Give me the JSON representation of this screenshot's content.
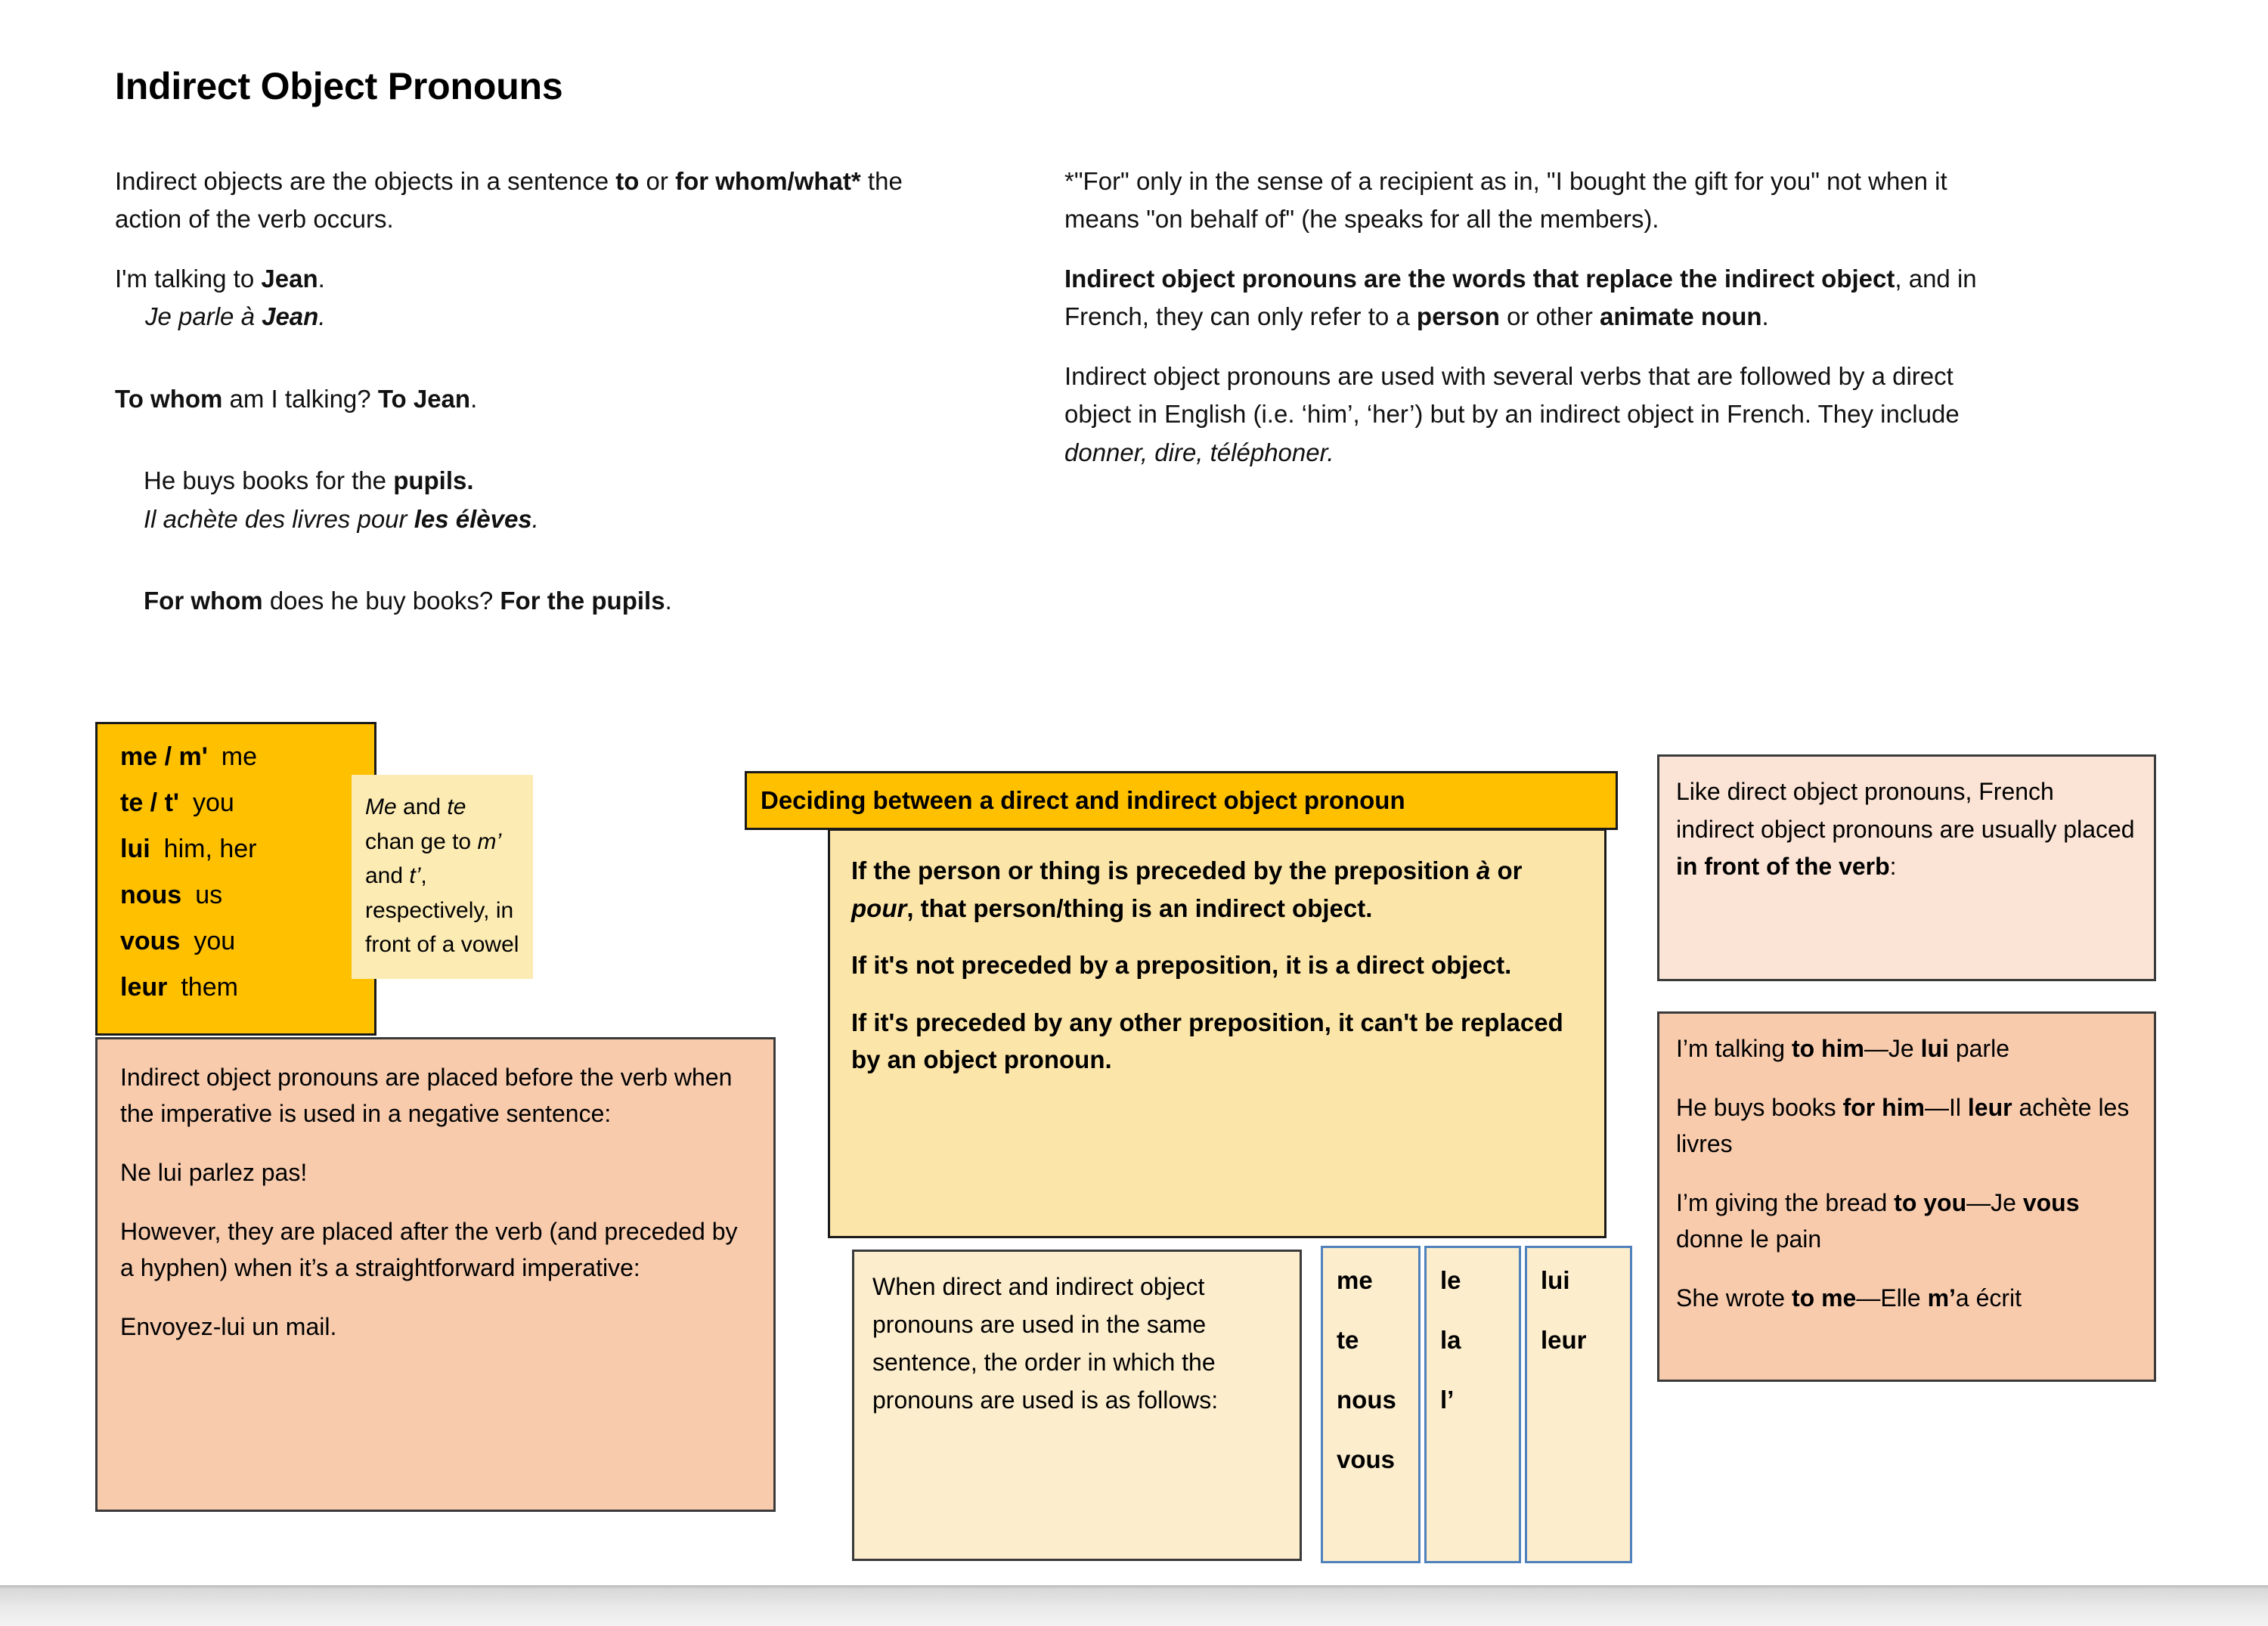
{
  "page_title": "Indirect Object Pronouns",
  "intro_left": {
    "definition_pre": "Indirect objects are the objects in a sentence ",
    "definition_b1": "to",
    "definition_mid": " or ",
    "definition_b2": "for whom/what*",
    "definition_post": " the action of the verb occurs.",
    "example1_en_pre": "I'm talking to ",
    "example1_en_b": "Jean",
    "example1_en_post": ".",
    "example1_fr_pre": "Je parle à ",
    "example1_fr_b": "Jean",
    "example1_fr_post": ".",
    "question1_b1": "To whom",
    "question1_mid": " am I talking? ",
    "question1_b2": "To Jean",
    "question1_post": ".",
    "example2_en_pre": "He buys books for the ",
    "example2_en_b": "pupils.",
    "example2_fr_pre": "Il achète des livres pour ",
    "example2_fr_b": "les élèves",
    "example2_fr_post": ".",
    "question2_b1": "For whom",
    "question2_mid": " does he buy books? ",
    "question2_b2": "For the pupils",
    "question2_post": "."
  },
  "intro_right": {
    "footnote": "*\"For\" only in the sense of a recipient as in, \"I bought the gift for you\" not when it means \"on behalf of\" (he speaks for all the members).",
    "replace_b1": "Indirect object pronouns are the words that replace the indirect object",
    "replace_mid": ", and in French, they can only refer to a ",
    "replace_b2": "person",
    "replace_mid2": " or other ",
    "replace_b3": "animate noun",
    "replace_post": ".",
    "verbs_text": "Indirect object pronouns are used with several verbs that are followed by a direct object in English (i.e. ‘him’, ‘her’) but by an indirect object in French. They include ",
    "verbs_italic": "donner, dire, téléphoner."
  },
  "pronoun_box": {
    "rows": [
      {
        "french": "me / m'",
        "english": "me"
      },
      {
        "french": "te / t'",
        "english": "you"
      },
      {
        "french": "lui",
        "english": "him, her"
      },
      {
        "french": "nous",
        "english": "us"
      },
      {
        "french": "vous",
        "english": "you"
      },
      {
        "french": "leur",
        "english": "them"
      }
    ]
  },
  "note_box": {
    "i1": "Me",
    "t1": " and ",
    "i2": "te",
    "t2": " chan ge to ",
    "i3": "m’",
    "t3": " and ",
    "i4": "t’",
    "t4": ", respectively, in front of a vowel"
  },
  "imperative_box": {
    "p1": "Indirect object pronouns are placed before the verb when the imperative is used in a negative sentence:",
    "p2": "Ne lui parlez pas!",
    "p3": "However, they are placed after the verb (and preceded by a hyphen) when it’s a straightforward imperative:",
    "p4": "Envoyez-lui un mail."
  },
  "decide_box": {
    "header": "Deciding between a direct and indirect object pronoun",
    "rule1_pre": "If the person or thing is preceded by the preposition ",
    "rule1_i1": "à",
    "rule1_mid": " or ",
    "rule1_i2": "pour",
    "rule1_post": ", that person/thing is an indirect object.",
    "rule2": "If it's not preceded by a preposition, it is a direct object.",
    "rule3": "If it's preceded by any other preposition, it can't be replaced by an object pronoun."
  },
  "order_box": {
    "text": "When direct and indirect object pronouns are used in the same sentence, the order in which the pronouns are used is as follows:"
  },
  "order_table": {
    "columns": [
      {
        "cells": [
          "me",
          "te",
          "nous",
          "vous"
        ]
      },
      {
        "cells": [
          "le",
          "la",
          "l’"
        ]
      },
      {
        "cells": [
          "lui",
          "leur"
        ]
      }
    ]
  },
  "placement_box": {
    "pre": "Like direct object pronouns, French indirect object pronouns are usually placed ",
    "bold": "in front of the verb",
    "post": ":"
  },
  "examples_box": {
    "ex1_pre": "I’m talking ",
    "ex1_b1": "to him",
    "ex1_mid": "—Je ",
    "ex1_b2": "lui",
    "ex1_post": " parle",
    "ex2_pre": "He buys books ",
    "ex2_b1": "for him",
    "ex2_mid": "—Il ",
    "ex2_b2": "leur",
    "ex2_post": " achète les livres",
    "ex3_pre": "I’m giving the bread ",
    "ex3_b1": "to you",
    "ex3_mid": "—Je ",
    "ex3_b2": "vous",
    "ex3_post": " donne le pain",
    "ex4_pre": "She wrote ",
    "ex4_b1": "to me",
    "ex4_mid": "—Elle ",
    "ex4_b2": "m’",
    "ex4_post": "a écrit"
  },
  "colors": {
    "gold": "#FFC000",
    "light_yellow": "#FCE5A8",
    "cream": "#FCEDCD",
    "note_cream": "#FDEBB4",
    "salmon": "#F8CBAD",
    "light_pink": "#FBE4D5",
    "table_border_blue": "#4F81BD"
  }
}
